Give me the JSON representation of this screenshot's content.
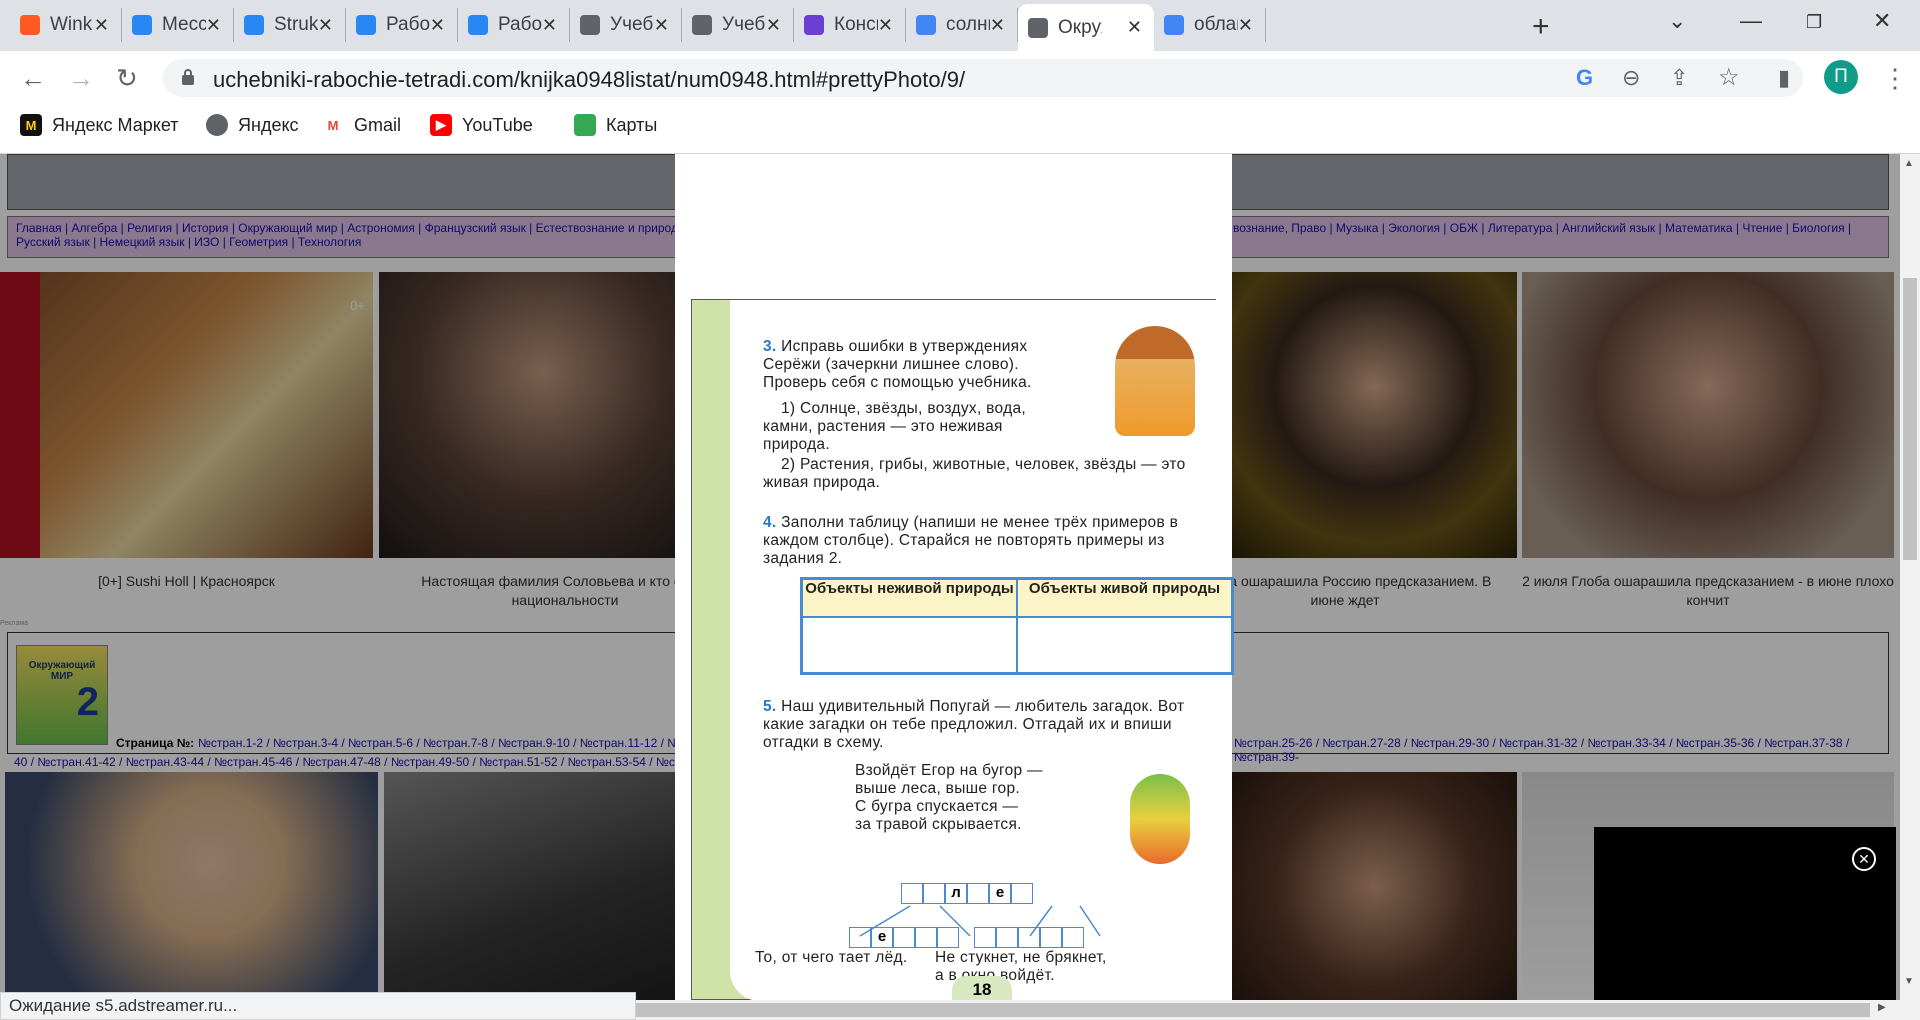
{
  "tabs": [
    {
      "title": "Wink",
      "icon": "wink-icon",
      "color": "#ff5a1f"
    },
    {
      "title": "Мессенджер",
      "icon": "messenger-icon",
      "color": "#2787f5"
    },
    {
      "title": "Struk",
      "icon": "vk-icon",
      "color": "#2787f5"
    },
    {
      "title": "Работы",
      "icon": "vk-icon",
      "color": "#2787f5"
    },
    {
      "title": "Работы",
      "icon": "vk-icon",
      "color": "#2787f5"
    },
    {
      "title": "Учебник",
      "icon": "globe-icon",
      "color": "#5f6368"
    },
    {
      "title": "Учебник",
      "icon": "globe-icon",
      "color": "#5f6368"
    },
    {
      "title": "Конспект",
      "icon": "konspekt-icon",
      "color": "#6a3fd1"
    },
    {
      "title": "солнце",
      "icon": "google-icon",
      "color": "#4285f4"
    },
    {
      "title": "Окружающий",
      "icon": "globe-icon",
      "color": "#5f6368"
    },
    {
      "title": "облако",
      "icon": "google-icon",
      "color": "#4285f4"
    }
  ],
  "address": {
    "url": "uchebniki-rabochie-tetradi.com/knijka0948listat/num0948.html#prettyPhoto/9/"
  },
  "profile_initial": "П",
  "bookmarks": [
    {
      "label": "Яндекс Маркет",
      "icon": "yandex-market-icon"
    },
    {
      "label": "Яндекс",
      "icon": "globe-icon"
    },
    {
      "label": "Gmail",
      "icon": "gmail-icon"
    },
    {
      "label": "YouTube",
      "icon": "youtube-icon"
    },
    {
      "label": "Карты",
      "icon": "maps-icon"
    }
  ],
  "site_nav": {
    "line1": "Главная | Алгебра | Религия | История | Окружающий мир | Астрономия | Французский язык | Естествознание и природ",
    "line1b": "вознание, Право | Музыка | Экология | ОБЖ | Литература | Английский язык | Математика | Чтение | Биология |",
    "line2": "Русский язык | Немецкий язык | ИЗО | Геометрия | Технология"
  },
  "ads_row1": [
    {
      "caption": "[0+] Sushi Holl | Красноярск",
      "badge": "0+"
    },
    {
      "caption": "Настоящая фамилия Соловьева и кто он по национальности"
    },
    {
      "caption": "Глоба ошарашила Россию предсказанием. В июне ждет"
    },
    {
      "caption": "2 июля Глоба ошарашила предсказанием - в июне плохо кончит"
    }
  ],
  "ad_label": "Реклама",
  "book": {
    "cover_title": "Окружающий МИР",
    "cover_num": "2",
    "pages_label": "Страница №:",
    "links_a": "№стран.1-2 / №стран.3-4 / №стран.5-6 / №стран.7-8 / №стран.9-10 / №стран.11-12 / №",
    "links_b": "№стран.25-26 / №стран.27-28 / №стран.29-30 / №стран.31-32 / №стран.33-34 / №стран.35-36 / №стран.37-38 / №стран.39-",
    "links_c": "40 / №стран.41-42 / №стран.43-44 / №стран.45-46 / №стран.47-48 / №стран.49-50 / №стран.51-52 / №стран.53-54 / №ст"
  },
  "workbook": {
    "ex3_num": "3.",
    "ex3_text": "Исправь ошибки в утверждениях Серёжи (зачеркни лишнее слово). Проверь себя с помощью учебника.",
    "ex3_item1": "1) Солнце, звёзды, воздух, вода, камни, растения — это неживая природа.",
    "ex3_item2": "2) Растения, грибы, животные, человек, звёзды — это живая природа.",
    "ex4_num": "4.",
    "ex4_text": "Заполни таблицу (напиши не менее трёх примеров в каждом столбце). Старайся не повторять примеры из задания 2.",
    "col1": "Объекты неживой природы",
    "col2": "Объекты живой природы",
    "ex5_num": "5.",
    "ex5_text": "Наш удивительный Попугай — любитель загадок. Вот какие загадки он тебе предложил. Отгадай их и впиши отгадки в схему.",
    "riddle1_l1": "Взойдёт Егор на бугор —",
    "riddle1_l2": "выше леса, выше гор.",
    "riddle1_l3": "С бугра спускается —",
    "riddle1_l4": "за травой скрывается.",
    "top_letters": [
      "",
      "",
      "л",
      "",
      "е",
      ""
    ],
    "left_letters": [
      "",
      "е",
      "",
      "",
      ""
    ],
    "right_letters": [
      "",
      "",
      "",
      "",
      ""
    ],
    "riddle2": "То, от чего тает лёд.",
    "riddle3_l1": "Не стукнет, не брякнет,",
    "riddle3_l2": "а в окно войдёт.",
    "page_number": "18"
  },
  "status_text": "Ожидание s5.adstreamer.ru..."
}
